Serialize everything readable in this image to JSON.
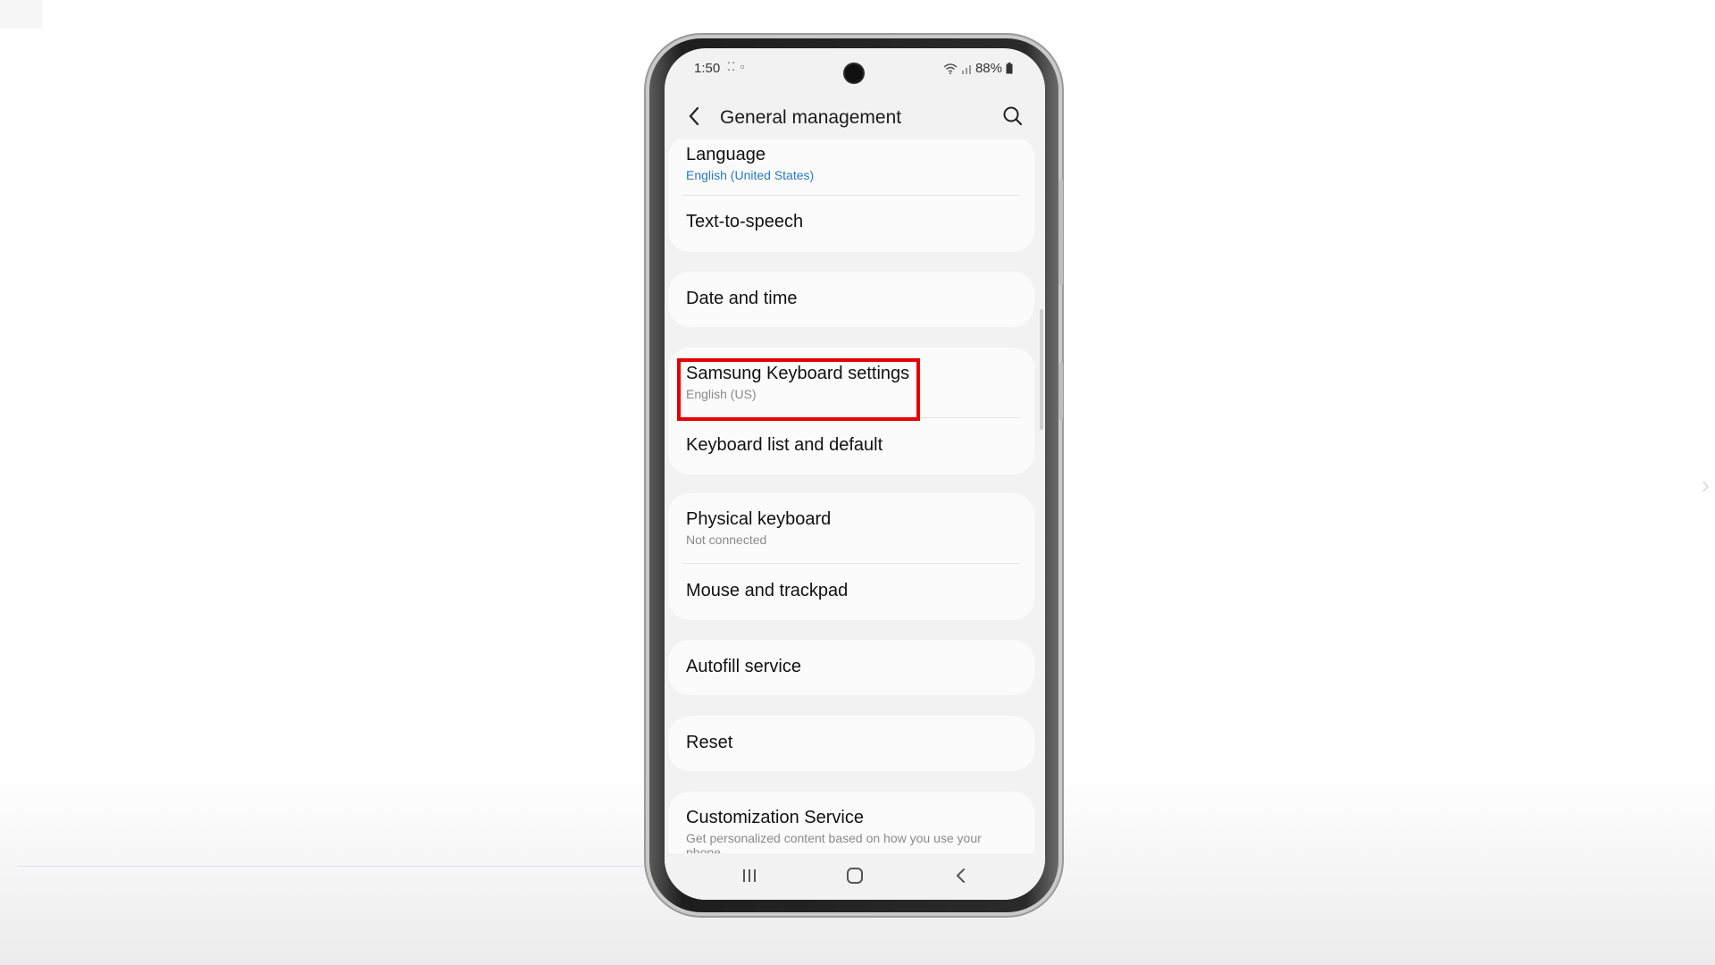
{
  "status_bar": {
    "time": "1:50",
    "battery": "88%",
    "indicators": [
      "wifi-icon",
      "signal-icon",
      "battery-icon"
    ]
  },
  "app_bar": {
    "title": "General management",
    "back_icon": "back-arrow-icon",
    "search_icon": "search-icon"
  },
  "groups": [
    {
      "items": [
        {
          "title": "Language",
          "subtitle": "English (United States)"
        },
        {
          "title": "Text-to-speech"
        }
      ]
    },
    {
      "items": [
        {
          "title": "Date and time"
        }
      ]
    },
    {
      "items": [
        {
          "title": "Samsung Keyboard settings",
          "subtitle": "English (US)",
          "highlighted": true
        },
        {
          "title": "Keyboard list and default"
        }
      ]
    },
    {
      "items": [
        {
          "title": "Physical keyboard",
          "subtitle": "Not connected"
        },
        {
          "title": "Mouse and trackpad"
        }
      ]
    },
    {
      "items": [
        {
          "title": "Autofill service"
        }
      ]
    },
    {
      "items": [
        {
          "title": "Reset"
        }
      ]
    },
    {
      "items": [
        {
          "title": "Customization Service",
          "subtitle": "Get personalized content based on how you use your phone."
        }
      ]
    }
  ],
  "colors": {
    "highlight_border": "#e60000",
    "subtitle_accent": "#2a79c5"
  },
  "nav_bar": {
    "recents_icon": "recents-icon",
    "home_icon": "home-icon",
    "back_icon": "nav-back-icon"
  }
}
